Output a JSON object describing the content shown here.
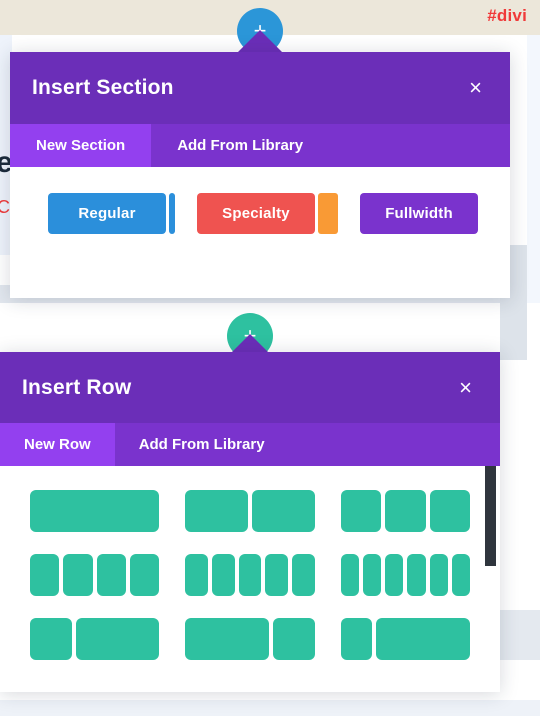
{
  "background": {
    "hashtag": "#divi",
    "hashtag_color": "#f03a3a",
    "band_color": "#ece7da",
    "ghost_letter": "e",
    "ghost_red_text": "C",
    "ghost_red_text_2": "c"
  },
  "add_buttons": [
    {
      "name": "add-section",
      "glyph": "+",
      "color": "#2b96d8"
    },
    {
      "name": "add-row",
      "glyph": "+",
      "color": "#2ec1a0"
    }
  ],
  "insert_section_modal": {
    "title": "Insert Section",
    "close_glyph": "×",
    "tabs": [
      {
        "label": "New Section",
        "active": true
      },
      {
        "label": "Add From Library",
        "active": false
      }
    ],
    "buttons": [
      {
        "label": "Regular",
        "color": "#2b8fdb"
      },
      {
        "label": "Specialty",
        "color": "#ef5350"
      },
      {
        "label": "Fullwidth",
        "color": "#7a33cd"
      }
    ],
    "slivers": [
      {
        "name": "regular-sliver",
        "color": "#2b8fdb",
        "width": 6
      },
      {
        "name": "specialty-sliver",
        "color": "#f99a35",
        "width": 20
      }
    ]
  },
  "insert_row_modal": {
    "title": "Insert Row",
    "close_glyph": "×",
    "tabs": [
      {
        "label": "New Row",
        "active": true
      },
      {
        "label": "Add From Library",
        "active": false
      }
    ],
    "column_color": "#2ec1a0",
    "layouts": [
      {
        "name": "layout-1-col",
        "columns": [
          1
        ]
      },
      {
        "name": "layout-2-col",
        "columns": [
          1,
          1
        ]
      },
      {
        "name": "layout-3-col",
        "columns": [
          1,
          1,
          1
        ]
      },
      {
        "name": "layout-4-col",
        "columns": [
          1,
          1,
          1,
          1
        ]
      },
      {
        "name": "layout-5-col",
        "columns": [
          1,
          1,
          1,
          1,
          1
        ]
      },
      {
        "name": "layout-6-col",
        "columns": [
          1,
          1,
          1,
          1,
          1,
          1
        ]
      },
      {
        "name": "layout-1-3-2-3",
        "columns": [
          1,
          2
        ]
      },
      {
        "name": "layout-2-3-1-3",
        "columns": [
          2,
          1
        ]
      },
      {
        "name": "layout-1-4-3-4",
        "columns": [
          1,
          3
        ]
      }
    ],
    "scrollbar": {
      "thumb_color": "#2f353d",
      "thumb_height": 100,
      "thumb_top": 0
    }
  }
}
